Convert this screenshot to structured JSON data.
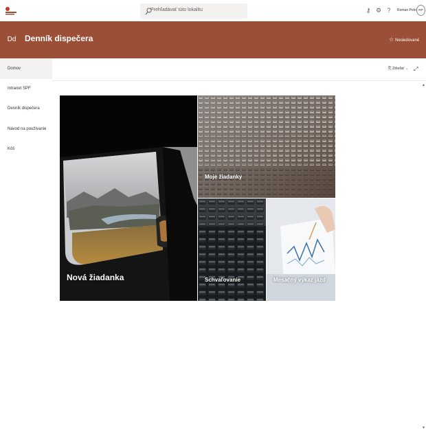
{
  "suitebar": {
    "search_placeholder": "Prehľadávať túto lokalitu",
    "user_name": "Roman Polník",
    "user_initials": "RP"
  },
  "site": {
    "logo_initials": "Dd",
    "title": "Denník dispečera",
    "follow_label": "Nesledované"
  },
  "nav": {
    "items": [
      {
        "label": "Domov",
        "active": true
      },
      {
        "label": "Intranet SPF"
      },
      {
        "label": "Denník dispečera"
      },
      {
        "label": "Návod na používanie"
      },
      {
        "label": "Kôš"
      }
    ]
  },
  "commandbar": {
    "share_label": "Zdieľať"
  },
  "hero": {
    "tiles": [
      {
        "label": "Nová žiadanka"
      },
      {
        "label": "Moje žiadanky"
      },
      {
        "label": "Schvaľovanie"
      },
      {
        "label": "Mesačný výkaz jázd"
      }
    ]
  },
  "colors": {
    "brand": "#9b4f36"
  },
  "icons": {
    "search": "search-icon",
    "key": "key-icon",
    "settings": "gear-icon",
    "help": "help-icon",
    "star": "star-icon",
    "share": "share-icon",
    "expand": "expand-icon"
  }
}
